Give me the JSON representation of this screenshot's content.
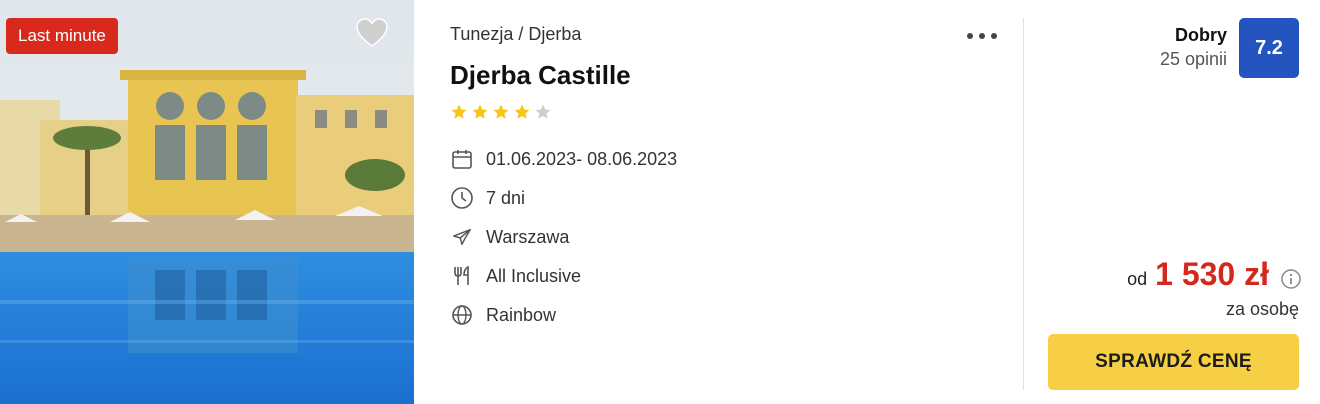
{
  "offer": {
    "badge": "Last minute",
    "breadcrumb": "Tunezja / Djerba",
    "title": "Djerba Castille",
    "stars": {
      "filled": 4,
      "total": 5
    },
    "facts": [
      {
        "icon": "calendar-icon",
        "text": "01.06.2023- 08.06.2023"
      },
      {
        "icon": "clock-icon",
        "text": "7 dni"
      },
      {
        "icon": "plane-icon",
        "text": "Warszawa"
      },
      {
        "icon": "cutlery-icon",
        "text": "All Inclusive"
      },
      {
        "icon": "globe-icon",
        "text": "Rainbow"
      }
    ]
  },
  "rating": {
    "label": "Dobry",
    "count": "25 opinii",
    "score": "7.2",
    "color": "#2454c0"
  },
  "price": {
    "prefix": "od",
    "amount": "1 530 zł",
    "per": "za osobę",
    "color": "#d3281e"
  },
  "cta": {
    "label": "SPRAWDŹ CENĘ",
    "color": "#f6cf44"
  },
  "colors": {
    "badge": "#d9291c",
    "star": "#f5c518",
    "star_empty": "#cfcfcf"
  }
}
